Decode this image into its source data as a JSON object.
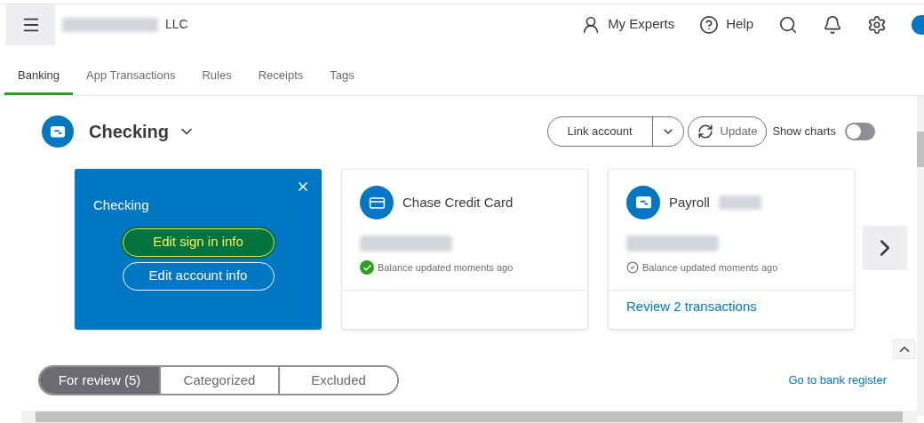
{
  "header": {
    "company_suffix": "LLC",
    "actions": [
      {
        "kind": "experts",
        "label": "My Experts"
      },
      {
        "kind": "help",
        "label": "Help"
      },
      {
        "kind": "search"
      },
      {
        "kind": "bell"
      },
      {
        "kind": "gear"
      }
    ]
  },
  "tabs": [
    {
      "label": "Banking",
      "selected": true
    },
    {
      "label": "App Transactions",
      "selected": false
    },
    {
      "label": "Rules",
      "selected": false
    },
    {
      "label": "Receipts",
      "selected": false
    },
    {
      "label": "Tags",
      "selected": false
    }
  ],
  "account": {
    "name": "Checking"
  },
  "toolbar": {
    "link_account": "Link account",
    "update": "Update",
    "show_charts": {
      "label": "Show charts",
      "on": false
    }
  },
  "popup": {
    "title": "Checking",
    "buttons": [
      {
        "label": "Edit sign in info",
        "highlighted": true
      },
      {
        "label": "Edit account info",
        "highlighted": false
      }
    ]
  },
  "cards": [
    {
      "kind": "card",
      "name": "Chase Credit Card",
      "status": "Balance updated moments ago",
      "verified": true
    },
    {
      "kind": "bank",
      "name": "Payroll",
      "status": "Balance updated moments ago",
      "verified": false,
      "link": "Review 2 transactions"
    }
  ],
  "filters": [
    {
      "label": "For review (5)",
      "selected": true
    },
    {
      "label": "Categorized",
      "selected": false
    },
    {
      "label": "Excluded",
      "selected": false
    }
  ],
  "register_link": "Go to bank register"
}
